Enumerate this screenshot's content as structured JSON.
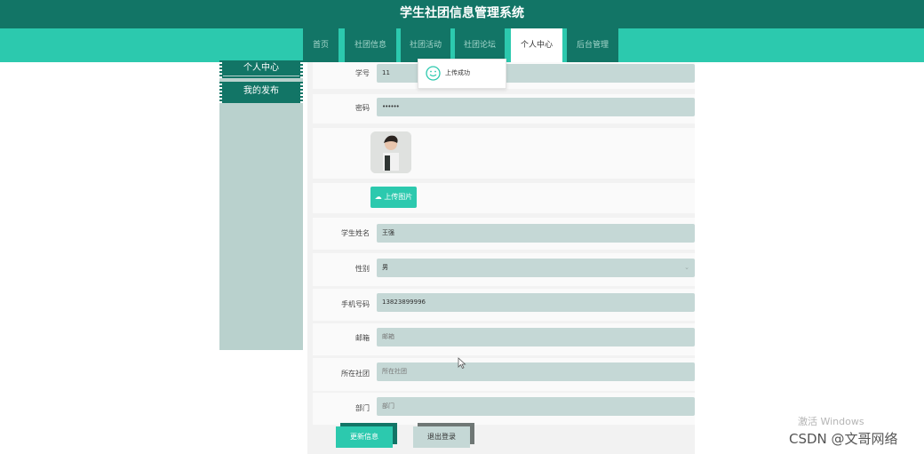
{
  "app": {
    "title": "学生社团信息管理系统"
  },
  "nav": {
    "tabs": [
      {
        "label": "首页"
      },
      {
        "label": "社团信息"
      },
      {
        "label": "社团活动"
      },
      {
        "label": "社团论坛"
      },
      {
        "label": "个人中心",
        "active": true
      },
      {
        "label": "后台管理"
      }
    ]
  },
  "sidebar": {
    "items": [
      {
        "label": "个人中心",
        "active": true
      },
      {
        "label": "我的发布"
      }
    ]
  },
  "toast": {
    "text": "上传成功"
  },
  "form": {
    "student_id": {
      "label": "学号",
      "value": "11"
    },
    "password": {
      "label": "密码",
      "value": "••••••"
    },
    "upload_label": "上传图片",
    "name": {
      "label": "学生姓名",
      "value": "王强"
    },
    "gender": {
      "label": "性别",
      "value": "男"
    },
    "phone": {
      "label": "手机号码",
      "value": "13823899996"
    },
    "email": {
      "label": "邮箱",
      "placeholder": "邮箱"
    },
    "club": {
      "label": "所在社团",
      "placeholder": "所在社团"
    },
    "department": {
      "label": "部门",
      "placeholder": "部门"
    }
  },
  "actions": {
    "update": "更新信息",
    "logout": "退出登录"
  },
  "watermark": {
    "activate": "激活 Windows",
    "credit": "CSDN @文哥网络"
  },
  "colors": {
    "header": "#127566",
    "band": "#2cc9ae",
    "field": "#c5d8d6",
    "sidebar": "#b9d1cd"
  }
}
